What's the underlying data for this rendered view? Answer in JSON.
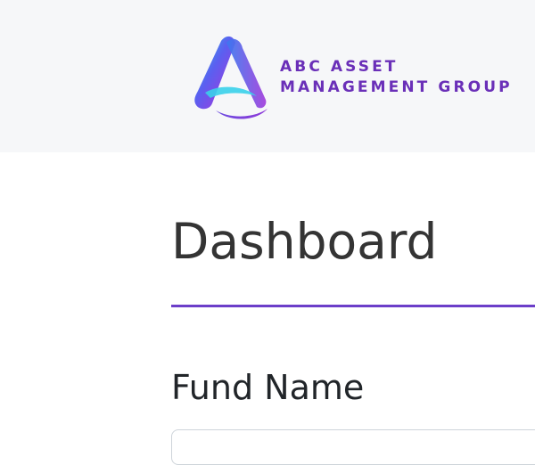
{
  "header": {
    "brand_line1": "ABC ASSET",
    "brand_line2": "MANAGEMENT GROUP",
    "logo_icon": "abc-a-logo-icon"
  },
  "main": {
    "title": "Dashboard",
    "fund_name_label": "Fund Name",
    "fund_name_value": ""
  },
  "colors": {
    "header_bg": "#f6f7f9",
    "brand_purple": "#6a2fb8",
    "rule_purple": "#6c3ec9",
    "title_text": "#343434"
  }
}
